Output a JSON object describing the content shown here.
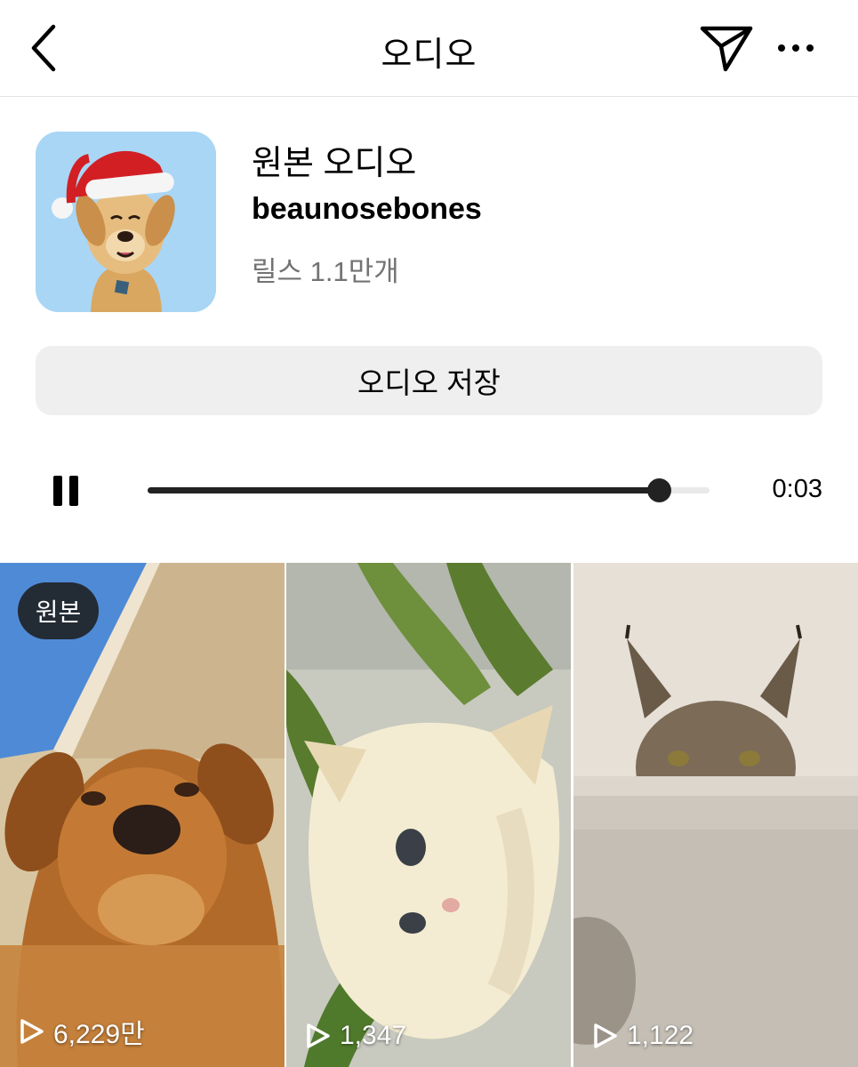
{
  "header": {
    "title": "오디오",
    "back_icon": "chevron-left-icon",
    "send_icon": "paper-plane-icon",
    "more_icon": "more-horizontal-icon"
  },
  "audio": {
    "title": "원본 오디오",
    "username": "beaunosebones",
    "reels_count": "릴스 1.1만개",
    "artwork": "dog-with-santa-hat"
  },
  "save_button": {
    "label": "오디오 저장"
  },
  "player": {
    "state": "playing",
    "control_icon": "pause-icon",
    "progress": 0.91,
    "time": "0:03"
  },
  "reels": [
    {
      "subject": "golden-retriever",
      "badge": "원본",
      "views": "6,229만"
    },
    {
      "subject": "kitten",
      "badge": "",
      "views": "1,347"
    },
    {
      "subject": "maine-coon-cat",
      "badge": "",
      "views": "1,122"
    }
  ],
  "colors": {
    "divider": "#e3e3e3",
    "button_bg": "#efefef",
    "secondary_text": "#737373",
    "artwork_bg": "#a9d6f5"
  }
}
